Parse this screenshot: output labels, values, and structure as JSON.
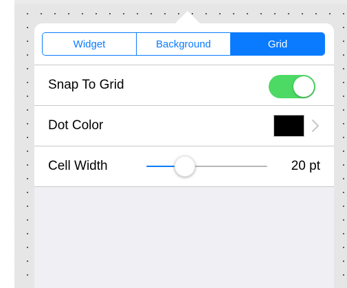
{
  "segments": {
    "items": [
      {
        "label": "Widget"
      },
      {
        "label": "Background"
      },
      {
        "label": "Grid"
      }
    ],
    "selected": "Grid"
  },
  "settings": {
    "snap": {
      "label": "Snap To Grid",
      "enabled": true
    },
    "dot_color": {
      "label": "Dot Color",
      "swatch_color": "#000000"
    },
    "cell_width": {
      "label": "Cell Width",
      "value_text": "20 pt",
      "slider_fraction": 0.32
    }
  },
  "colors": {
    "accent": "#0a7bff",
    "toggle_on": "#4cd964"
  },
  "icons": {
    "disclosure": "chevron-right-icon"
  }
}
